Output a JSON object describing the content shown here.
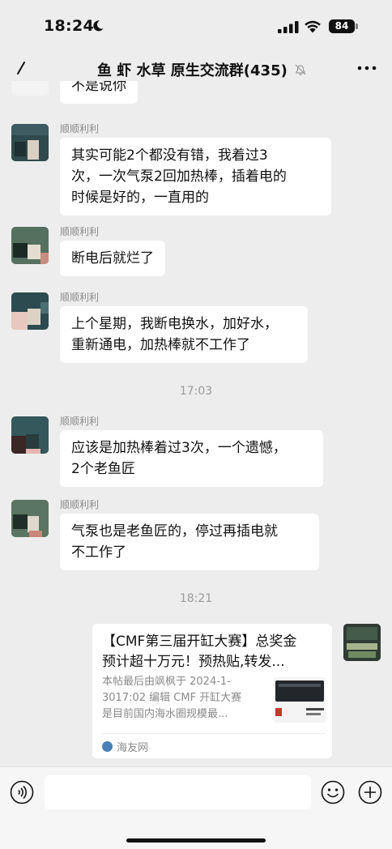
{
  "status_bar": {
    "time": "18:24",
    "battery": "84",
    "icons": [
      "moon-icon",
      "signal-icon",
      "wifi-icon",
      "battery-icon"
    ]
  },
  "navbar": {
    "title": "鱼 虾 水草 原生交流群(435)",
    "icons": [
      "back-icon",
      "mute-icon",
      "more-icon"
    ]
  },
  "messages": [
    {
      "type": "text",
      "sender": "",
      "text": "不是说你"
    },
    {
      "type": "text",
      "sender": "顺顺利利",
      "lines": [
        "其实可能2个都没有错，我着过3",
        "次，一次气泵2回加热棒，插着电的",
        "时候是好的，一直用的"
      ]
    },
    {
      "type": "text",
      "sender": "顺顺利利",
      "lines": [
        "断电后就烂了"
      ]
    },
    {
      "type": "text",
      "sender": "顺顺利利",
      "lines": [
        "上个星期，我断电换水，加好水，",
        "重新通电，加热棒就不工作了"
      ]
    },
    {
      "type": "time",
      "text": "17:03"
    },
    {
      "type": "text",
      "sender": "顺顺利利",
      "lines": [
        "应该是加热棒着过3次，一个遗憾，",
        "2个老鱼匠"
      ]
    },
    {
      "type": "text",
      "sender": "顺顺利利",
      "lines": [
        "气泵也是老鱼匠的，停过再插电就",
        "不工作了"
      ]
    },
    {
      "type": "time",
      "text": "18:21"
    }
  ],
  "article_card": {
    "title_lines": [
      "【CMF第三届开缸大赛】总奖金",
      "预计超十万元！预热贴,转发..."
    ],
    "desc_lines": [
      "本帖最后由飒枫于 2024-1-",
      "3017:02 编辑 CMF 开缸大赛",
      "是目前国内海水圈规模最..."
    ],
    "source": "海友网"
  },
  "input_bar": {
    "placeholder": "",
    "icons": [
      "voice-icon",
      "emoji-icon",
      "plus-icon"
    ]
  },
  "colors": {
    "background": "#ededed",
    "bubble": "#ffffff",
    "secondary_text": "#8a8a8a"
  }
}
